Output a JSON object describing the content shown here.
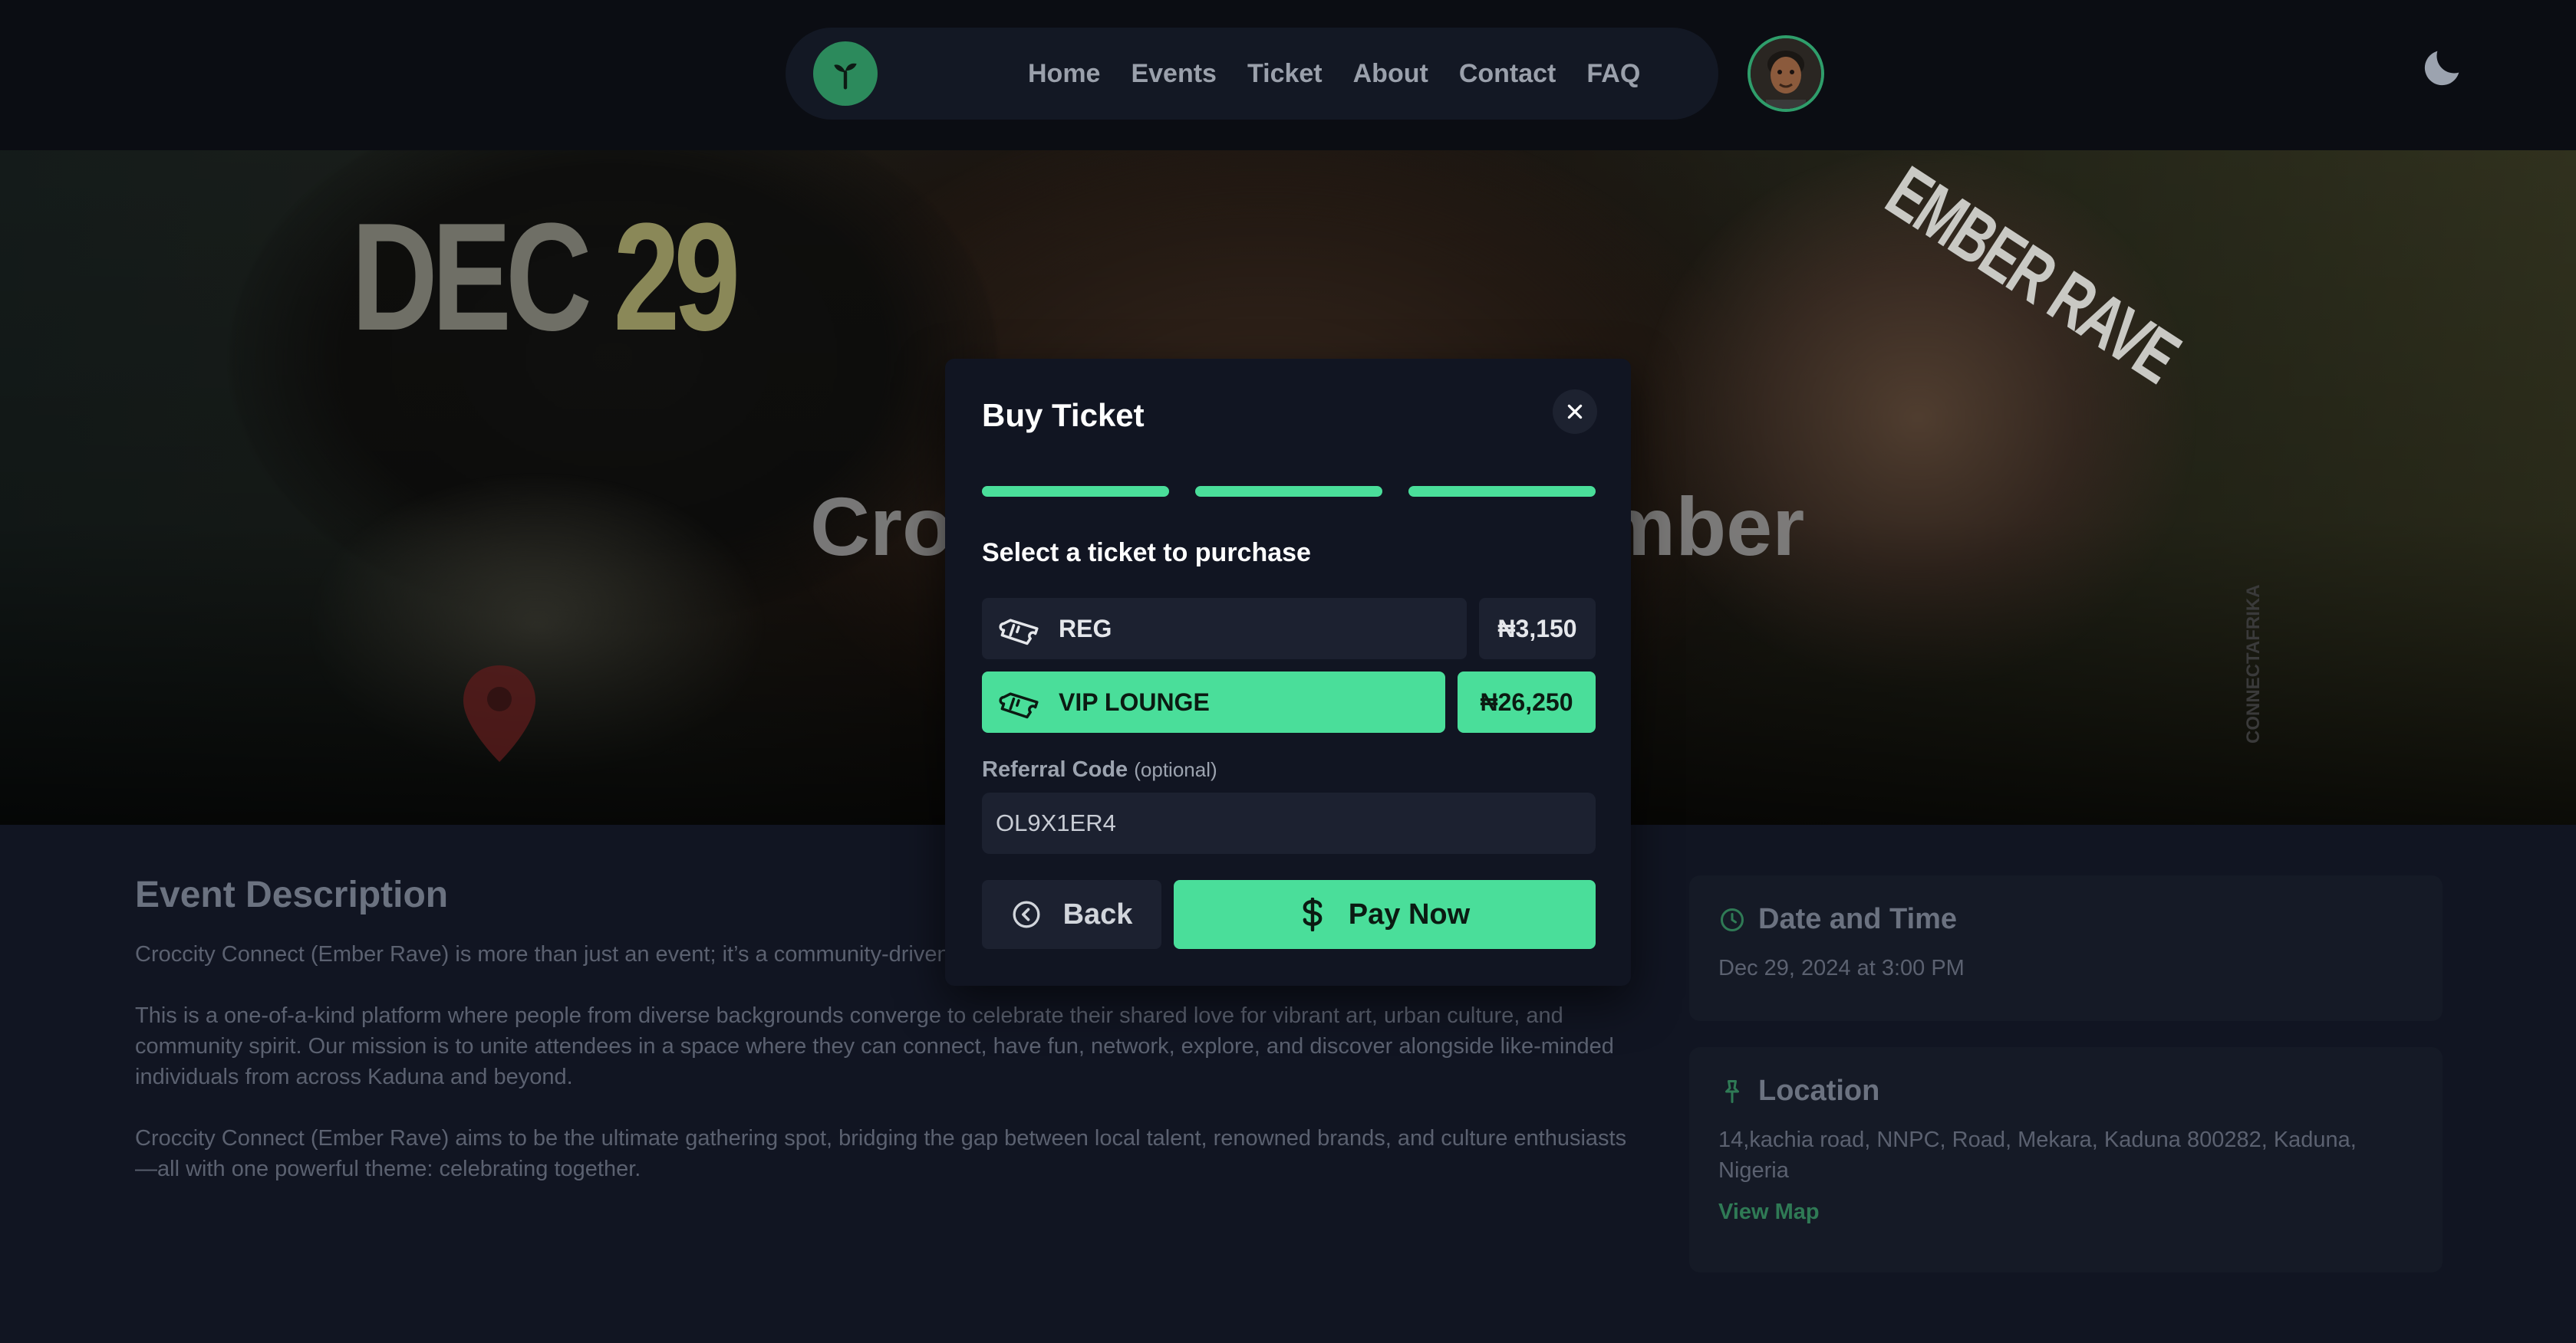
{
  "nav": {
    "links": [
      "Home",
      "Events",
      "Ticket",
      "About",
      "Contact",
      "FAQ"
    ]
  },
  "hero": {
    "date_month": "DEC",
    "date_day": "29",
    "sticker": "EMBER RAVE",
    "title": "Croccity Connect: Ember",
    "vertical_text": "CONNECTAFRIKA"
  },
  "description": {
    "title": "Event Description",
    "paragraphs": [
      "Croccity Connect (Ember Rave) is more than just an event; it’s a community-driven celebration of music, art, fashion, and culture.",
      "This is a one-of-a-kind platform where people from diverse backgrounds converge to celebrate their shared love for vibrant art, urban culture, and community spirit. Our mission is to unite attendees in a space where they can connect, have fun, network, explore, and discover alongside like-minded individuals from across Kaduna and beyond.",
      "Croccity Connect (Ember Rave) aims to be the ultimate gathering spot, bridging the gap between local talent, renowned brands, and culture enthusiasts—all with one powerful theme: celebrating together."
    ]
  },
  "date_card": {
    "title": "Date and Time",
    "value": "Dec 29, 2024 at 3:00 PM"
  },
  "location_card": {
    "title": "Location",
    "address": "14,kachia road, NNPC, Road, Mekara, Kaduna 800282, Kaduna, Nigeria",
    "link": "View Map"
  },
  "modal": {
    "title": "Buy Ticket",
    "progress_step": 3,
    "progress_total": 3,
    "subtitle": "Select a ticket to purchase",
    "tickets": [
      {
        "name": "REG",
        "price": "₦3,150",
        "selected": false
      },
      {
        "name": "VIP LOUNGE",
        "price": "₦26,250",
        "selected": true
      }
    ],
    "referral_label": "Referral Code",
    "referral_optional": "(optional)",
    "referral_value": "OL9X1ER4",
    "back_label": "Back",
    "pay_label": "Pay Now"
  },
  "colors": {
    "accent": "#4ade9a",
    "background": "#111522",
    "header": "#0b0d13"
  }
}
